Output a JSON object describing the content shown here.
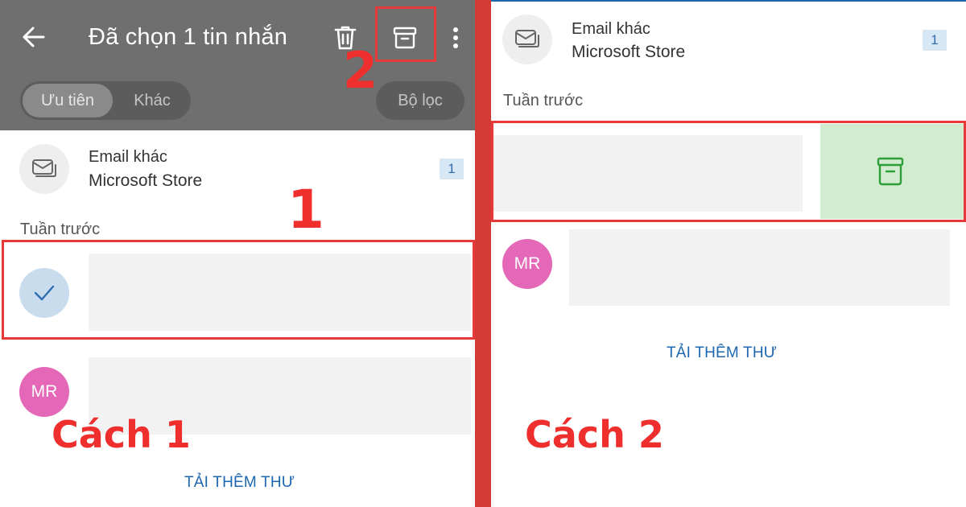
{
  "left": {
    "header": {
      "title": "Đã chọn 1 tin nhắn",
      "back_icon": "arrow-left-icon",
      "delete_icon": "trash-icon",
      "archive_icon": "archive-icon",
      "more_icon": "more-vertical-icon",
      "background": "#6f6f6f"
    },
    "tabs": {
      "focused": "Ưu tiên",
      "other": "Khác"
    },
    "filter_label": "Bộ lọc",
    "group_item": {
      "sender": "Email khác",
      "subject": "Microsoft Store",
      "count": "1"
    },
    "section_label": "Tuần trước",
    "avatar_initials": "MR",
    "load_more": "TẢI THÊM THƯ",
    "step_numbers": {
      "one": "1",
      "two": "2"
    },
    "caption": "Cách 1"
  },
  "right": {
    "group_item": {
      "sender": "Email khác",
      "subject": "Microsoft Store",
      "count": "1"
    },
    "section_label": "Tuần trước",
    "avatar_initials": "MR",
    "load_more": "TẢI THÊM THƯ",
    "swipe_action_icon": "archive-icon",
    "caption": "Cách 2"
  },
  "colors": {
    "highlight": "#e8393a",
    "annotation_text": "#ef2e2e",
    "divider": "#d23a36",
    "archive_swipe_bg": "#d2ecd0",
    "archive_swipe_icon": "#2e9e3a",
    "link_blue": "#1d66b0",
    "badge_bg": "#d8e7f4",
    "avatar_mr": "#e467b8"
  }
}
